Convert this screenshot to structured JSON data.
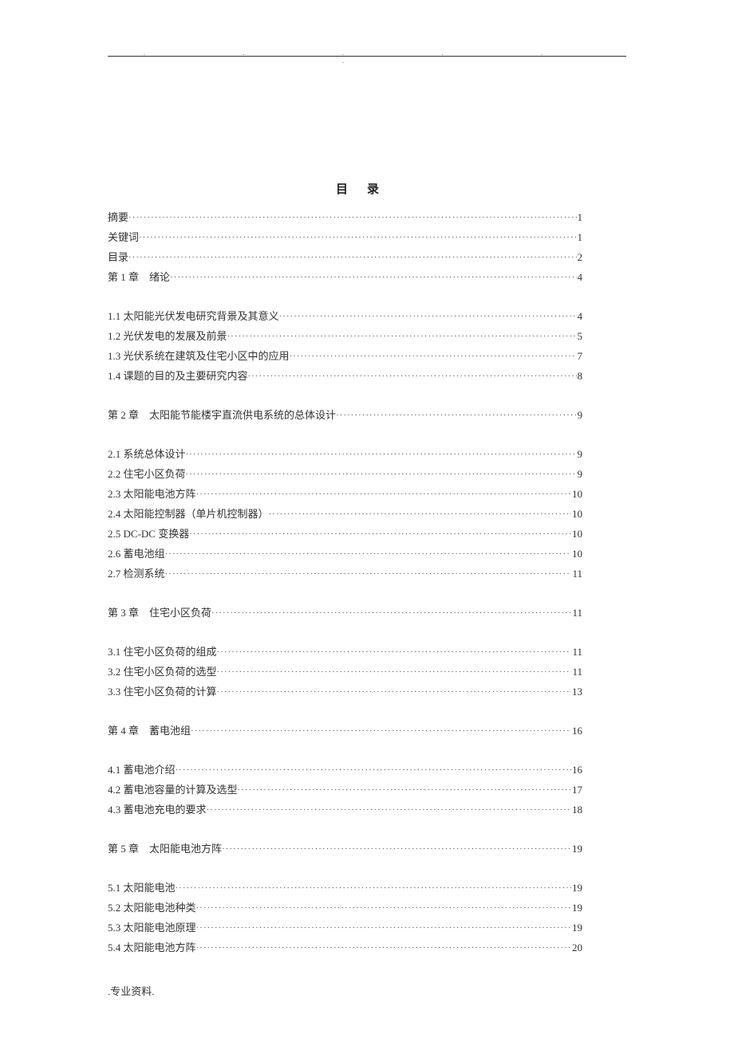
{
  "header_dots": ". .        . .        . .",
  "toc_title": "目录",
  "front_matter": [
    {
      "label": "摘要",
      "page": "1"
    },
    {
      "label": "关键词",
      "page": "1"
    },
    {
      "label": "目录",
      "page": "2"
    },
    {
      "label": "第 1 章 绪论",
      "page": "4"
    }
  ],
  "ch1_items": [
    {
      "label": "1.1 太阳能光伏发电研究背景及其意义",
      "page": "4"
    },
    {
      "label": "1.2 光伏发电的发展及前景",
      "page": "5"
    },
    {
      "label": "1.3 光伏系统在建筑及住宅小区中的应用",
      "page": "7"
    },
    {
      "label": "1.4 课题的目的及主要研究内容",
      "page": "8"
    }
  ],
  "ch2_header": {
    "label": "第 2 章 太阳能节能楼宇直流供电系统的总体设计",
    "page": "9"
  },
  "ch2_items": [
    {
      "label": "2.1 系统总体设计",
      "page": "9"
    },
    {
      "label": "2.2 住宅小区负荷",
      "page": "9"
    },
    {
      "label": "2.3 太阳能电池方阵",
      "page": "10"
    },
    {
      "label": "2.4 太阳能控制器（单片机控制器）",
      "page": "10"
    },
    {
      "label": "2.5 DC-DC 变换器",
      "page": "10"
    },
    {
      "label": "2.6 蓄电池组",
      "page": "10"
    },
    {
      "label": "2.7 检测系统",
      "page": "11"
    }
  ],
  "ch3_header": {
    "label": "第 3 章 住宅小区负荷",
    "page": "11"
  },
  "ch3_items": [
    {
      "label": "3.1 住宅小区负荷的组成",
      "page": "11"
    },
    {
      "label": "3.2 住宅小区负荷的选型",
      "page": "11"
    },
    {
      "label": "3.3 住宅小区负荷的计算",
      "page": "13"
    }
  ],
  "ch4_header": {
    "label": "第 4 章 蓄电池组",
    "page": "16"
  },
  "ch4_items": [
    {
      "label": "4.1 蓄电池介绍",
      "page": "16"
    },
    {
      "label": "4.2 蓄电池容量的计算及选型",
      "page": "17"
    },
    {
      "label": "4.3 蓄电池充电的要求",
      "page": "18"
    }
  ],
  "ch5_header": {
    "label": "第 5 章 太阳能电池方阵",
    "page": "19"
  },
  "ch5_items": [
    {
      "label": "5.1 太阳能电池",
      "page": "19"
    },
    {
      "label": "5.2 太阳能电池种类",
      "page": "19"
    },
    {
      "label": "5.3 太阳能电池原理",
      "page": "19"
    },
    {
      "label": "5.4  太阳能电池方阵",
      "page": "20"
    }
  ],
  "footer": ".专业资料."
}
